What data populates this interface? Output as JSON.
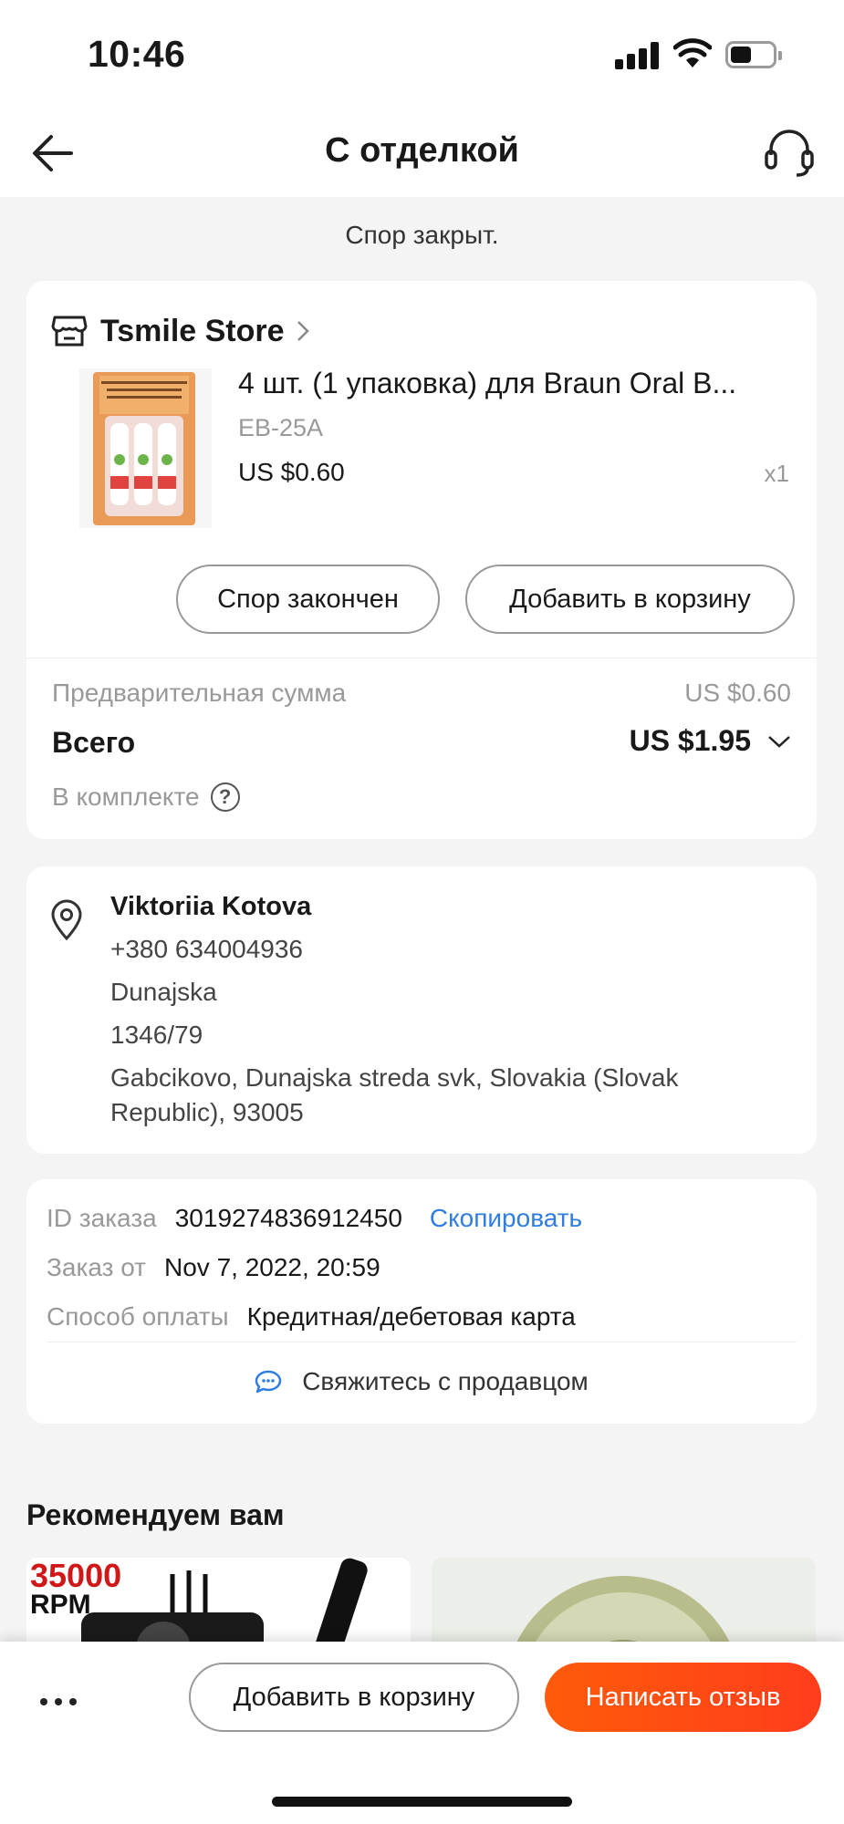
{
  "status_bar": {
    "time": "10:46"
  },
  "header": {
    "title": "С отделкой"
  },
  "dispute_status": "Спор закрыт.",
  "order": {
    "store_name": "Tsmile Store",
    "product_title": "4 шт. (1 упаковка) для Braun Oral B...",
    "product_variant": "EB-25A",
    "product_price": "US $0.60",
    "product_qty": "x1",
    "dispute_button": "Спор закончен",
    "add_to_cart_button": "Добавить в корзину",
    "subtotal_label": "Предварительная сумма",
    "subtotal_value": "US $0.60",
    "total_label": "Всего",
    "total_value": "US $1.95",
    "included_label": "В комплекте"
  },
  "address": {
    "name": "Viktoriia Kotova",
    "phone": "+380 634004936",
    "street": "Dunajska",
    "house": "1346/79",
    "city_line1": "Gabcikovo, Dunajska streda svk, Slovakia (Slovak",
    "city_line2": "Republic), 93005"
  },
  "order_info": {
    "id_label": "ID заказа",
    "id_value": "3019274836912450",
    "copy_label": "Скопировать",
    "date_label": "Заказ от",
    "date_value": "Nov 7, 2022, 20:59",
    "payment_label": "Способ оплаты",
    "payment_value": "Кредитная/дебетовая карта",
    "contact_seller": "Свяжитесь с продавцом"
  },
  "recommendations": {
    "title": "Рекомендуем вам",
    "tile1_badge_number": "35000",
    "tile1_badge_unit": "RPM"
  },
  "bottom_bar": {
    "more_label": "...",
    "add_to_cart_button": "Добавить в корзину",
    "review_button": "Написать отзыв"
  },
  "colors": {
    "accent_orange": "#ff4e12",
    "link_blue": "#2f7de1",
    "background": "#f4f4f4"
  },
  "icons": [
    "back-arrow-icon",
    "headset-icon",
    "store-icon",
    "chevron-right-icon",
    "chevron-down-icon",
    "help-icon",
    "location-pin-icon",
    "chat-icon"
  ]
}
